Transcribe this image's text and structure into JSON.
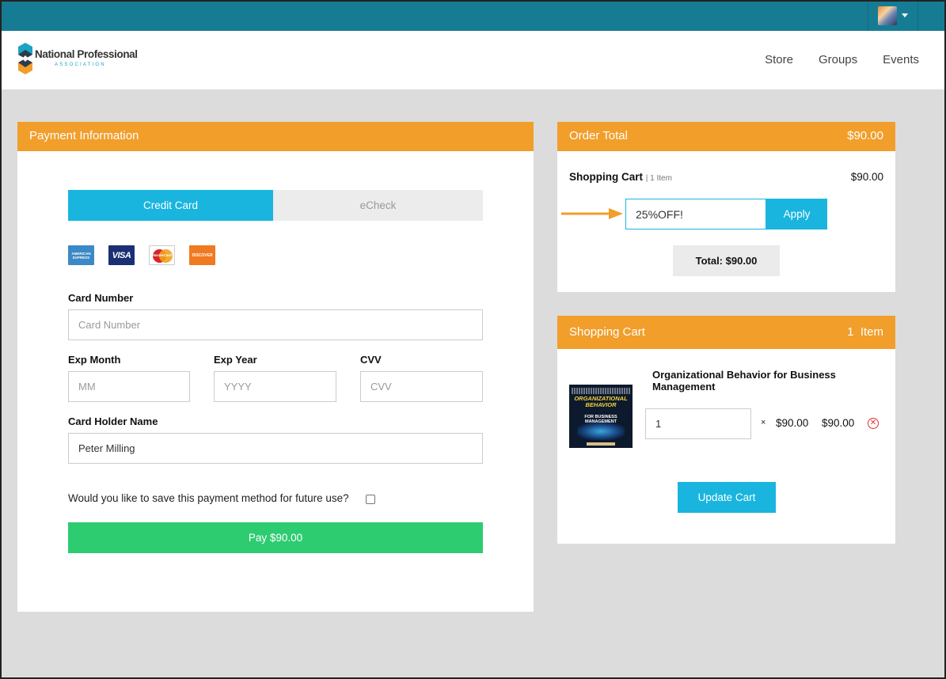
{
  "brand": {
    "name": "National Professional",
    "tagline": "ASSOCIATION",
    "colors": {
      "teal": "#167c94",
      "orange": "#f19e2b",
      "blue": "#19b5de",
      "green": "#2ecc71"
    }
  },
  "nav": {
    "items": [
      "Store",
      "Groups",
      "Events"
    ]
  },
  "user_menu": {
    "avatar": "user-avatar",
    "icon": "caret-down-icon"
  },
  "payment": {
    "header": "Payment Information",
    "tabs": [
      {
        "label": "Credit Card",
        "active": true
      },
      {
        "label": "eCheck",
        "active": false
      }
    ],
    "card_logos": [
      {
        "name": "amex-icon",
        "text": "AMERICAN EXPRESS"
      },
      {
        "name": "visa-icon",
        "text": "VISA"
      },
      {
        "name": "mastercard-icon",
        "text": "MasterCard"
      },
      {
        "name": "discover-icon",
        "text": "DISCOVER"
      }
    ],
    "card_number": {
      "label": "Card Number",
      "placeholder": "Card Number",
      "value": ""
    },
    "exp_month": {
      "label": "Exp Month",
      "placeholder": "MM",
      "value": ""
    },
    "exp_year": {
      "label": "Exp Year",
      "placeholder": "YYYY",
      "value": ""
    },
    "cvv": {
      "label": "CVV",
      "placeholder": "CVV",
      "value": ""
    },
    "holder": {
      "label": "Card Holder Name",
      "value": "Peter Milling"
    },
    "save_question": "Would you like to save this payment method for future use?",
    "save_checked": false,
    "pay_button": "Pay $90.00"
  },
  "order_total": {
    "header": "Order Total",
    "header_amount": "$90.00",
    "cart_label": "Shopping Cart",
    "cart_count": "| 1 Item",
    "cart_amount": "$90.00",
    "coupon_value": "25%OFF!",
    "apply_button": "Apply",
    "total_text": "Total: $90.00"
  },
  "shopping_cart": {
    "header": "Shopping Cart",
    "header_count": "1  Item",
    "items": [
      {
        "name": "Organizational Behavior for Business Management",
        "quantity": "1",
        "times": "×",
        "unit_price": "$90.00",
        "line_total": "$90.00",
        "cover": {
          "title": "ORGANIZATIONAL BEHAVIOR",
          "sub": "FOR BUSINESS MANAGEMENT"
        }
      }
    ],
    "update_button": "Update Cart"
  }
}
